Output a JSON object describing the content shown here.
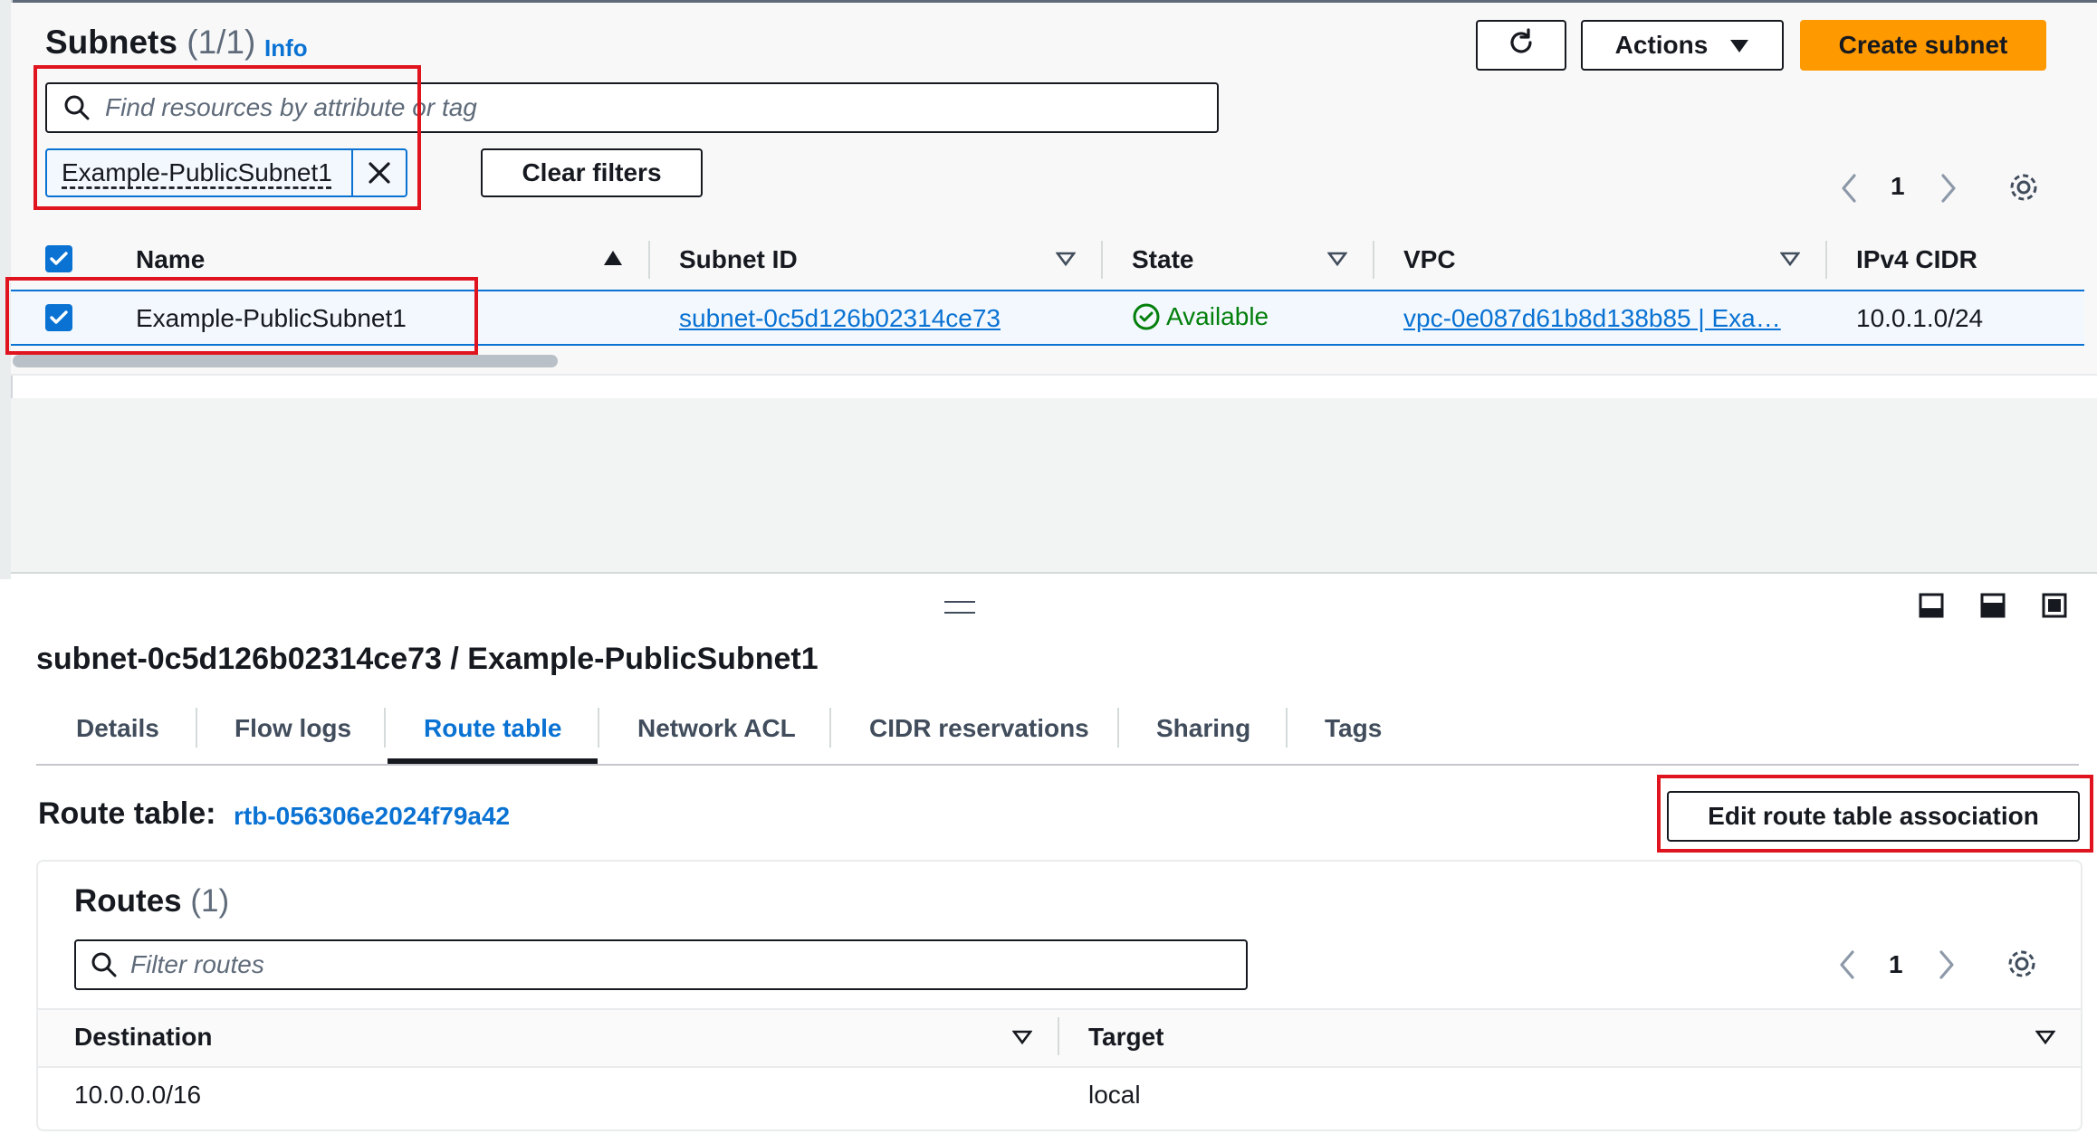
{
  "subnets": {
    "title": "Subnets",
    "count": "(1/1)",
    "info": "Info",
    "actions_label": "Actions",
    "create_label": "Create subnet",
    "search_placeholder": "Find resources by attribute or tag",
    "filter_chip": "Example-PublicSubnet1",
    "clear_filters": "Clear filters",
    "page": "1",
    "columns": [
      "Name",
      "Subnet ID",
      "State",
      "VPC",
      "IPv4 CIDR"
    ],
    "rows": [
      {
        "name": "Example-PublicSubnet1",
        "subnet_id": "subnet-0c5d126b02314ce73",
        "state": "Available",
        "vpc": "vpc-0e087d61b8d138b85 | Exa…",
        "cidr": "10.0.1.0/24",
        "selected": true
      }
    ]
  },
  "details": {
    "heading": "subnet-0c5d126b02314ce73 / Example-PublicSubnet1",
    "tabs": [
      "Details",
      "Flow logs",
      "Route table",
      "Network ACL",
      "CIDR reservations",
      "Sharing",
      "Tags"
    ],
    "active_tab": "Route table",
    "route_table_label": "Route table:",
    "route_table_id": "rtb-056306e2024f79a42",
    "edit_button": "Edit route table association"
  },
  "routes": {
    "title": "Routes",
    "count": "(1)",
    "filter_placeholder": "Filter routes",
    "page": "1",
    "columns": [
      "Destination",
      "Target"
    ],
    "rows": [
      {
        "destination": "10.0.0.0/16",
        "target": "local"
      }
    ]
  },
  "colors": {
    "accent": "#0972d3",
    "primary_button": "#ff9900",
    "highlight": "#e0141e",
    "success": "#037f0c"
  }
}
